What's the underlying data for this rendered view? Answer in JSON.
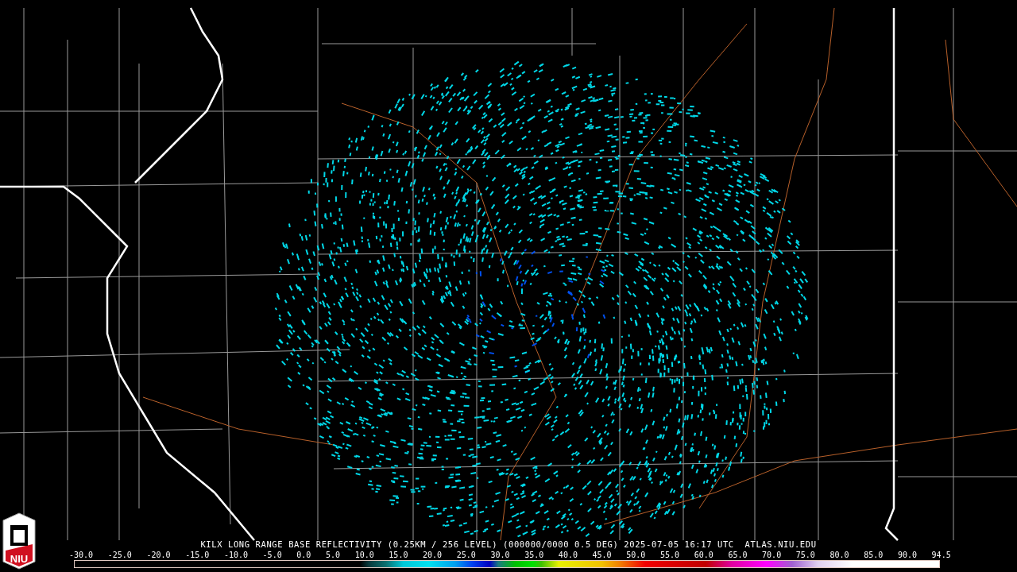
{
  "logo": {
    "text": "NIU"
  },
  "title": "KILX LONG RANGE BASE REFLECTIVITY (0.25KM / 256 LEVEL) (000000/0000 0.5 DEG) 2025-07-05 16:17 UTC  ATLAS.NIU.EDU",
  "legend": {
    "ticks": [
      "-30.0",
      "-25.0",
      "-20.0",
      "-15.0",
      "-10.0",
      "-5.0",
      "0.0",
      "5.0",
      "10.0",
      "15.0",
      "20.0",
      "25.0",
      "30.0",
      "35.0",
      "40.0",
      "45.0",
      "50.0",
      "55.0",
      "60.0",
      "65.0",
      "70.0",
      "75.0",
      "80.0",
      "85.0",
      "90.0",
      "94.5"
    ]
  }
}
